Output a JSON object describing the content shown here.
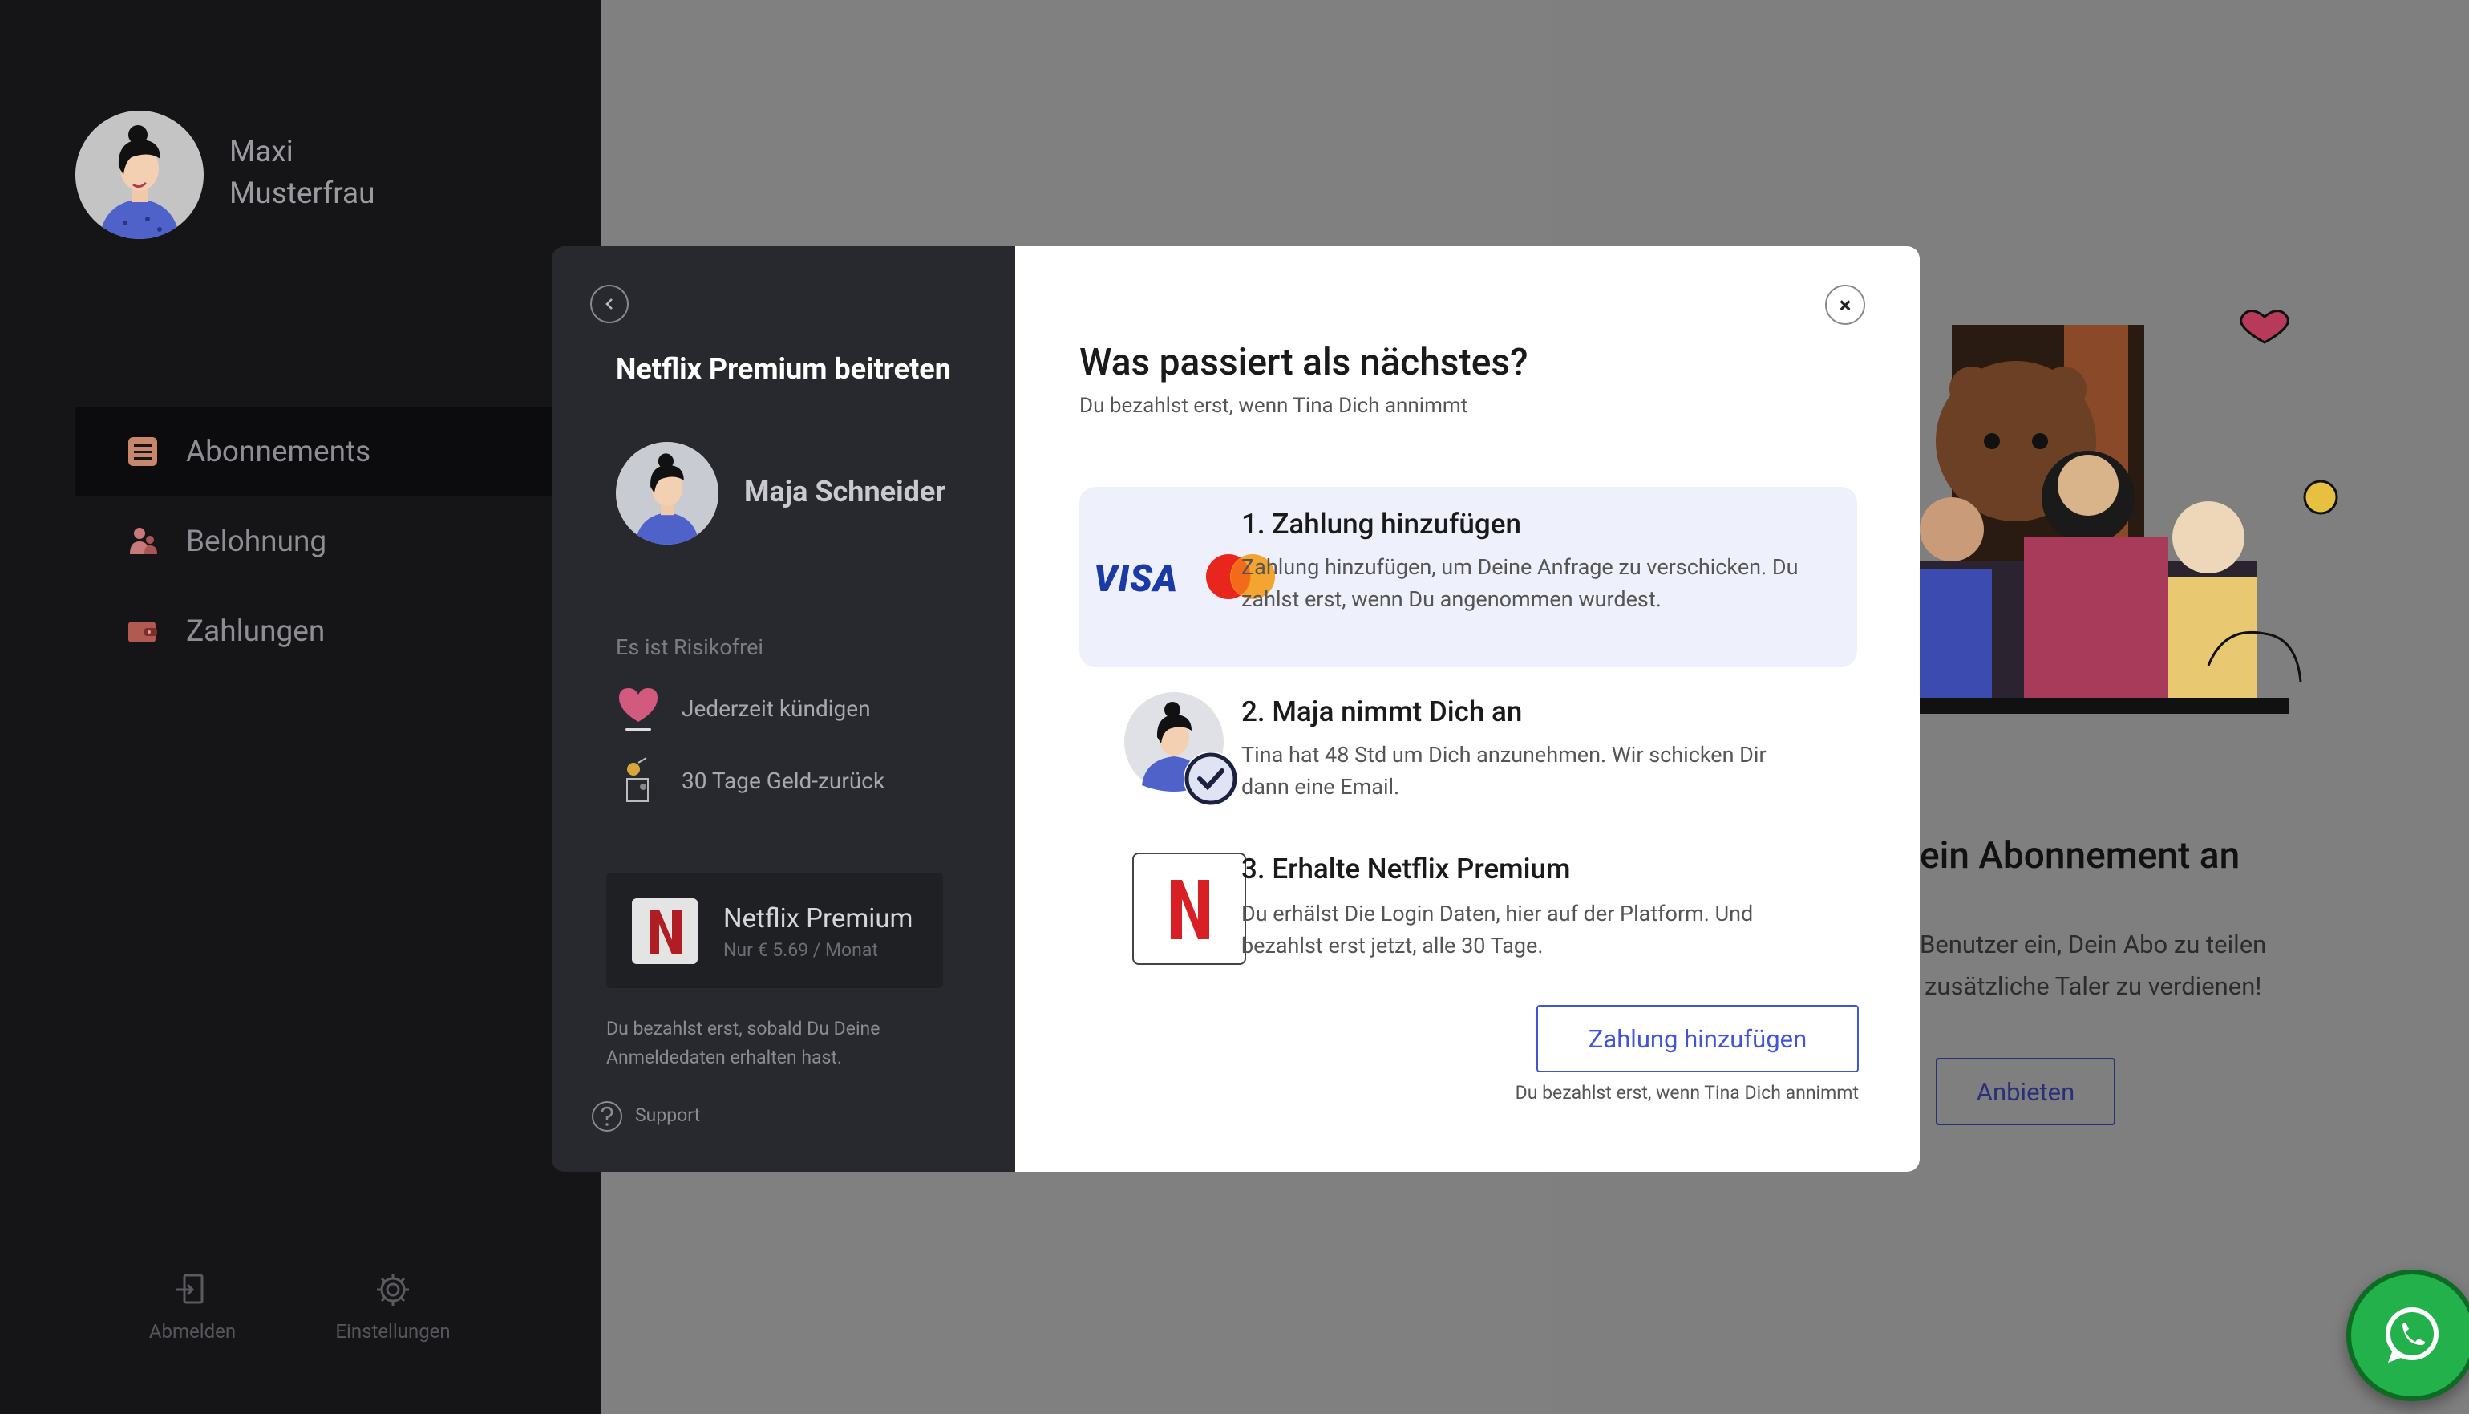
{
  "sidebar": {
    "user": {
      "first_name": "Maxi",
      "last_name": "Musterfrau"
    },
    "nav": [
      {
        "label": "Abonnements",
        "icon": "list-icon",
        "active": true
      },
      {
        "label": "Belohnung",
        "icon": "users-icon",
        "active": false
      },
      {
        "label": "Zahlungen",
        "icon": "wallet-icon",
        "active": false
      }
    ],
    "footer": [
      {
        "label": "Abmelden",
        "icon": "logout-icon"
      },
      {
        "label": "Einstellungen",
        "icon": "gear-icon"
      }
    ]
  },
  "background": {
    "heading": "ein Abonnement an",
    "text_line1": "Benutzer ein, Dein Abo zu teilen",
    "text_line2": "zusätzliche Taler zu verdienen!",
    "button": "Anbieten"
  },
  "modal": {
    "left": {
      "title": "Netflix Premium beitreten",
      "host_name": "Maja Schneider",
      "risk_heading": "Es ist Risikofrei",
      "features": [
        {
          "label": "Jederzeit kündigen",
          "icon": "heart-icon"
        },
        {
          "label": "30 Tage Geld-zurück",
          "icon": "money-back-icon"
        }
      ],
      "plan": {
        "name": "Netflix Premium",
        "price": "Nur € 5.69 / Monat"
      },
      "note": "Du bezahlst erst, sobald Du Deine Anmeldedaten erhalten hast.",
      "support": "Support"
    },
    "right": {
      "title": "Was passiert als nächstes?",
      "subtitle": "Du bezahlst erst, wenn Tina Dich annimmt",
      "steps": [
        {
          "title": "1. Zahlung hinzufügen",
          "text": "Zahlung hinzufügen, um Deine Anfrage zu verschicken. Du zahlst erst, wenn Du angenommen wurdest.",
          "visa": "VISA"
        },
        {
          "title": "2. Maja nimmt Dich an",
          "text": "Tina hat 48 Std um Dich anzunehmen. Wir schicken Dir dann eine Email."
        },
        {
          "title": "3. Erhalte Netflix Premium",
          "text": "Du erhälst Die Login Daten, hier auf der Platform. Und bezahlst erst jetzt, alle 30 Tage.",
          "netflix_letter": "N"
        }
      ],
      "button": "Zahlung hinzufügen",
      "button_note": "Du bezahlst erst, wenn Tina Dich annimmt",
      "close": "×"
    }
  },
  "colors": {
    "accent": "#4254d8",
    "netflix_red": "#d81f26",
    "whatsapp": "#23b14b"
  }
}
